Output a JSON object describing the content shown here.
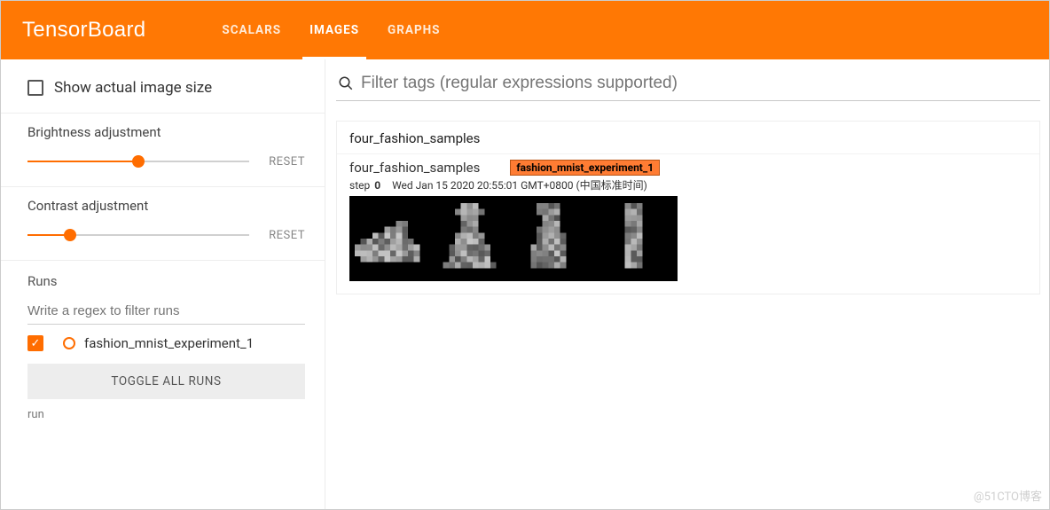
{
  "header": {
    "logo": "TensorBoard",
    "tabs": {
      "scalars": "SCALARS",
      "images": "IMAGES",
      "graphs": "GRAPHS"
    }
  },
  "sidebar": {
    "show_actual_size_label": "Show actual image size",
    "brightness": {
      "title": "Brightness adjustment",
      "reset": "RESET",
      "value_pct": 50
    },
    "contrast": {
      "title": "Contrast adjustment",
      "reset": "RESET",
      "value_pct": 19
    },
    "runs": {
      "heading": "Runs",
      "filter_placeholder": "Write a regex to filter runs",
      "items": [
        {
          "name": "fashion_mnist_experiment_1",
          "checked": true,
          "color": "#ff6d00"
        }
      ],
      "toggle_all": "TOGGLE ALL RUNS",
      "legend": "run"
    }
  },
  "main": {
    "filter_placeholder": "Filter tags (regular expressions supported)",
    "card": {
      "tag": "four_fashion_samples",
      "image_title": "four_fashion_samples",
      "run_label": "fashion_mnist_experiment_1",
      "step_label": "step",
      "step_value": "0",
      "timestamp": "Wed Jan 15 2020 20:55:01 GMT+0800 (中国标准时间)"
    }
  },
  "watermark": "@51CTO博客"
}
